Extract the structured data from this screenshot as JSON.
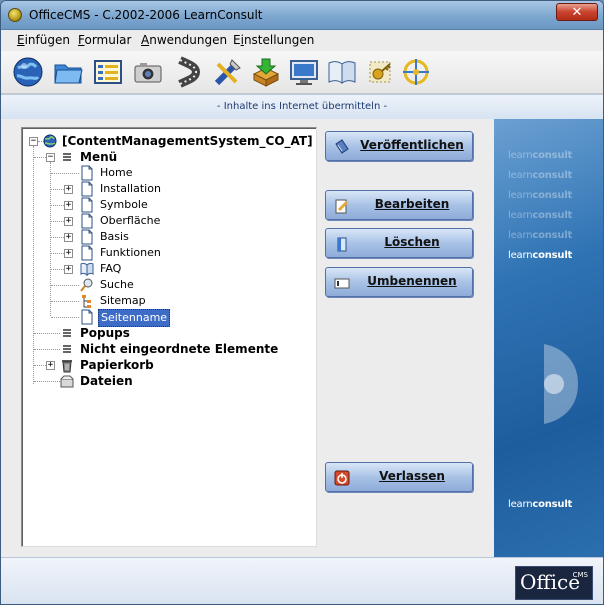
{
  "window": {
    "title": "OfficeCMS - C.2002-2006 LearnConsult",
    "close_label": "✕"
  },
  "menu": {
    "items": [
      {
        "label": "Einfügen",
        "underline": "E"
      },
      {
        "label": "Formular",
        "underline": "F"
      },
      {
        "label": "Anwendungen",
        "underline": "A"
      },
      {
        "label": "Einstellungen",
        "underline": "i"
      }
    ]
  },
  "toolbar": {
    "buttons": [
      {
        "icon": "globe-icon"
      },
      {
        "icon": "folder-icon"
      },
      {
        "icon": "form-icon"
      },
      {
        "icon": "camera-icon"
      },
      {
        "icon": "film-icon"
      },
      {
        "icon": "tools-icon"
      },
      {
        "icon": "download-box-icon"
      },
      {
        "icon": "monitor-icon"
      },
      {
        "icon": "book-icon"
      },
      {
        "icon": "key-icon"
      },
      {
        "icon": "compass-icon"
      }
    ]
  },
  "status": {
    "text": "- Inhalte ins Internet übermitteln -"
  },
  "tree": {
    "root": "[ContentManagementSystem_CO_AT]",
    "menu_label": "Menü",
    "menu_children": [
      {
        "label": "Home",
        "expandable": false,
        "icon": "page-icon"
      },
      {
        "label": "Installation",
        "expandable": true,
        "icon": "page-icon"
      },
      {
        "label": "Symbole",
        "expandable": true,
        "icon": "page-icon"
      },
      {
        "label": "Oberfläche",
        "expandable": true,
        "icon": "page-icon"
      },
      {
        "label": "Basis",
        "expandable": true,
        "icon": "page-icon"
      },
      {
        "label": "Funktionen",
        "expandable": true,
        "icon": "page-icon"
      },
      {
        "label": "FAQ",
        "expandable": true,
        "icon": "faq-icon"
      },
      {
        "label": "Suche",
        "expandable": false,
        "icon": "search-icon"
      },
      {
        "label": "Sitemap",
        "expandable": false,
        "icon": "sitemap-icon"
      },
      {
        "label": "Seitenname",
        "expandable": false,
        "icon": "page-icon",
        "selected": true
      }
    ],
    "popups": "Popups",
    "unassigned": "Nicht eingeordnete Elemente",
    "trash": "Papierkorb",
    "files": "Dateien"
  },
  "actions": {
    "publish": "Veröffentlichen",
    "edit": "Bearbeiten",
    "delete": "Löschen",
    "rename": "Umbenennen",
    "exit": "Verlassen"
  },
  "brand": {
    "logo_light": "learn",
    "logo_bold": "consult",
    "badge_main": "Office",
    "badge_sub": "CMS"
  },
  "colors": {
    "accent": "#3d6cc6",
    "button_top": "#d9e6f7",
    "button_bottom": "#8eabd9",
    "brand_panel": "#2f73b4",
    "close_red": "#c9432e"
  }
}
